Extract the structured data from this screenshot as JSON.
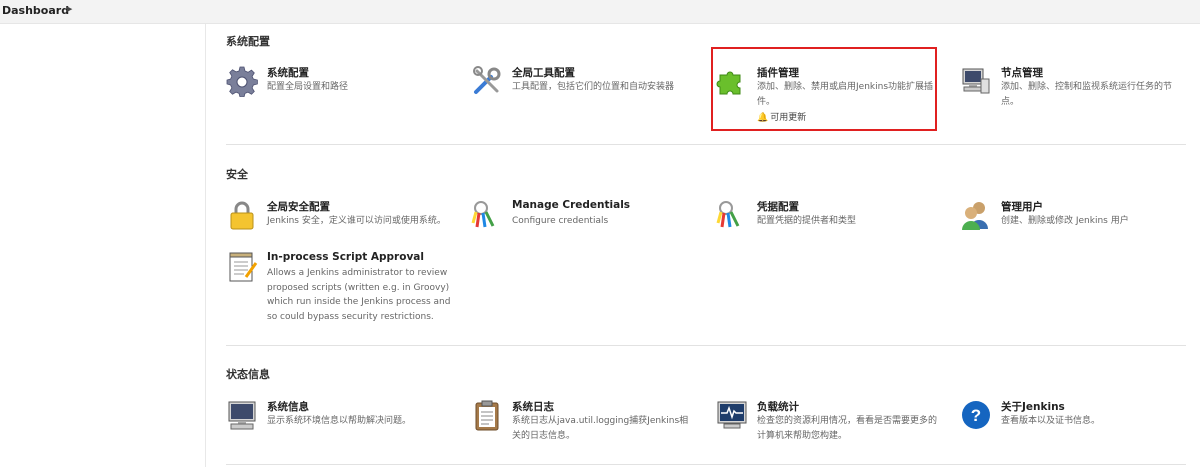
{
  "breadcrumb": {
    "label": "Dashboard",
    "arrow_icon": "chevron-right-icon"
  },
  "sections": {
    "system": {
      "title": "系统配置",
      "items": {
        "system_config": {
          "title": "系统配置",
          "desc": "配置全局设置和路径",
          "icon": "gear-icon"
        },
        "global_tools": {
          "title": "全局工具配置",
          "desc": "工具配置，包括它们的位置和自动安装器",
          "icon": "tools-icon"
        },
        "plugins": {
          "title": "插件管理",
          "desc": "添加、删除、禁用或启用Jenkins功能扩展插件。",
          "update": "可用更新",
          "icon": "puzzle-icon",
          "update_icon": "bell-icon"
        },
        "nodes": {
          "title": "节点管理",
          "desc": "添加、删除、控制和监视系统运行任务的节点。",
          "icon": "computer-icon"
        }
      }
    },
    "security": {
      "title": "安全",
      "items": {
        "global_security": {
          "title": "全局安全配置",
          "desc": "Jenkins 安全，定义谁可以访问或使用系统。",
          "icon": "lock-icon"
        },
        "manage_credentials": {
          "title": "Manage Credentials",
          "desc": "Configure credentials",
          "icon": "keys-icon"
        },
        "credentials_config": {
          "title": "凭据配置",
          "desc": "配置凭据的提供者和类型",
          "icon": "keys-search-icon"
        },
        "manage_users": {
          "title": "管理用户",
          "desc": "创建、删除或修改 Jenkins 用户",
          "icon": "users-icon"
        },
        "script_approval": {
          "title": "In-process Script Approval",
          "desc": "Allows a Jenkins administrator to review proposed scripts (written e.g. in Groovy) which run inside the Jenkins process and so could bypass security restrictions.",
          "icon": "notepad-icon"
        }
      }
    },
    "status": {
      "title": "状态信息",
      "items": {
        "system_info": {
          "title": "系统信息",
          "desc": "显示系统环境信息以帮助解决问题。",
          "icon": "monitor-icon"
        },
        "system_log": {
          "title": "系统日志",
          "desc": "系统日志从java.util.logging捕获Jenkins相关的日志信息。",
          "icon": "clipboard-icon"
        },
        "load_stats": {
          "title": "负载统计",
          "desc": "检查您的资源利用情况，看看是否需要更多的计算机来帮助您构建。",
          "icon": "pulse-monitor-icon"
        },
        "about": {
          "title": "关于Jenkins",
          "desc": "查看版本以及证书信息。",
          "icon": "help-icon"
        }
      }
    }
  },
  "colors": {
    "highlight": "#e02020",
    "help_blue": "#1565c0",
    "puzzle_green": "#6abf2c"
  }
}
